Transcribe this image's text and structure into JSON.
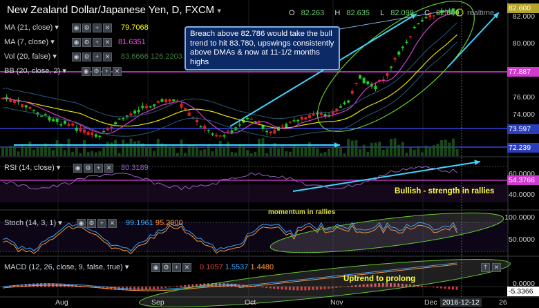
{
  "header": {
    "title": "New Zealand Dollar/Japanese Yen, D, FXCM",
    "ohlc": [
      {
        "key": "O",
        "value": "82.263"
      },
      {
        "key": "H",
        "value": "82.635"
      },
      {
        "key": "L",
        "value": "82.098"
      },
      {
        "key": "C",
        "value": "82.600"
      }
    ],
    "realtime_label": "realtime"
  },
  "indicators": {
    "ma21": {
      "label": "MA (21, close)",
      "value": "79.7068",
      "color": "#ffff00"
    },
    "ma7": {
      "label": "MA (7, close)",
      "value": "81.6351",
      "color": "#ff44ff"
    },
    "vol": {
      "label": "Vol (20, false)",
      "value": "83.6666",
      "value2": "126.2203",
      "color": "#3d7a3d"
    },
    "bb": {
      "label": "BB (20, close, 2)"
    },
    "rsi": {
      "label": "RSI (14, close)",
      "value": "80.3189"
    },
    "stoch": {
      "label": "Stoch (14, 3, 1)",
      "k": "99.1961",
      "d": "95.2900"
    },
    "macd": {
      "label": "MACD (12, 26, close, 9, false, true)",
      "v1": "0.1057",
      "v2": "1.5537",
      "v3": "1.4480"
    }
  },
  "callout": "Breach above 82.786 would take the bull trend to hit 83.780, upswings consistently above DMAs & now at 11-1/2 months highs",
  "annotations": {
    "rsi_note": "Bullish - strength in rallies",
    "stoch_note": "momentum in rallies",
    "macd_note": "Uptrend to prolong"
  },
  "price_axis": {
    "ticks": [
      "82.000",
      "80.000",
      "76.000",
      "74.000"
    ],
    "tags": [
      {
        "text": "82.600",
        "color": "#b5a52a"
      },
      {
        "text": "77.887",
        "color": "#d03ad0"
      },
      {
        "text": "73.597",
        "color": "#2b3db8"
      },
      {
        "text": "72.239",
        "color": "#2b3db8"
      }
    ]
  },
  "rsi_axis": {
    "ticks": [
      "60.0000",
      "40.0000"
    ],
    "tag": {
      "text": "54.3766",
      "color": "#d03ad0"
    }
  },
  "stoch_axis": {
    "ticks": [
      "100.0000",
      "50.0000"
    ]
  },
  "macd_axis": {
    "ticks": [
      "0.0000"
    ],
    "tag": {
      "text": "-5.3366",
      "color": "#ffffff"
    }
  },
  "time_axis": {
    "labels": [
      "Aug",
      "Sep",
      "Oct",
      "Nov",
      "Dec",
      "2016-12-12",
      "26"
    ]
  },
  "colors": {
    "bull": "#22cc22",
    "bear": "#e02020",
    "background": "#000000",
    "accent": "#3ad8ff"
  },
  "icons": [
    "chevron-down-icon",
    "eye-icon",
    "gear-icon",
    "plus-icon",
    "close-icon",
    "up-arrow-icon"
  ]
}
